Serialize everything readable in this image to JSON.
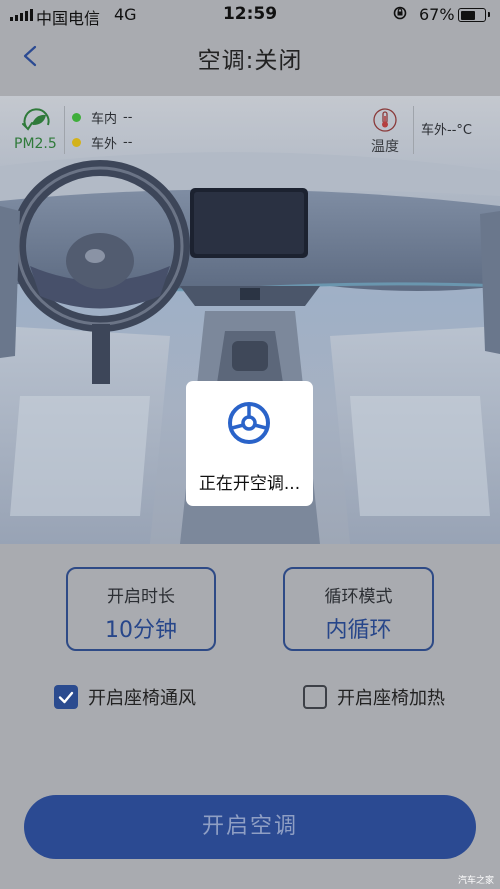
{
  "status_bar": {
    "carrier": "中国电信",
    "network": "4G",
    "time": "12:59",
    "battery_percent": "67%",
    "battery_level": 0.67
  },
  "nav": {
    "title": "空调:关闭",
    "back_icon": "chevron-left-icon"
  },
  "air_quality": {
    "pm_label": "PM2.5",
    "pm_icon": "pm25-leaf-icon",
    "inside": {
      "label": "车内",
      "value": "--",
      "color": "#3fae3b"
    },
    "outside": {
      "label": "车外",
      "value": "--",
      "color": "#d3b21a"
    }
  },
  "temperature": {
    "icon": "thermometer-icon",
    "label": "温度",
    "outside_text": "车外--°C"
  },
  "loading": {
    "icon": "steering-wheel-icon",
    "text": "正在开空调..."
  },
  "settings": {
    "duration": {
      "label": "开启时长",
      "value": "10分钟"
    },
    "cycle": {
      "label": "循环模式",
      "value": "内循环"
    }
  },
  "options": {
    "seat_vent": {
      "label": "开启座椅通风",
      "checked": true
    },
    "seat_heat": {
      "label": "开启座椅加热",
      "checked": false
    }
  },
  "action": {
    "label": "开启空调"
  },
  "watermark": "汽车之家",
  "colors": {
    "brand": "#2b4a92",
    "pm_green": "#2f7a3a"
  }
}
